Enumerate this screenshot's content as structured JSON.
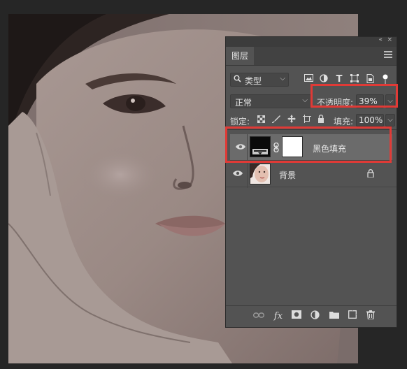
{
  "panel": {
    "collapse_icon": "«",
    "close_icon": "×",
    "tab_label": "图层",
    "menu_icon": "panel-menu-icon"
  },
  "filter": {
    "icon": "🔍",
    "label": "类型",
    "chevron": "⌵",
    "icons": [
      "image-filter-icon",
      "adjustment-filter-icon",
      "type-filter-icon",
      "shape-filter-icon",
      "smart-object-filter-icon",
      "filter-toggle-icon"
    ]
  },
  "blend": {
    "mode": "正常",
    "chevron": "⌵",
    "opacity_label": "不透明度:",
    "opacity_value": "39%",
    "opacity_chevron": "⌵"
  },
  "lock": {
    "label": "锁定:",
    "fill_label": "填充:",
    "fill_value": "100%",
    "fill_chevron": "⌵"
  },
  "layers": [
    {
      "name": "黑色填充",
      "selected": true,
      "visible": true,
      "type": "fill-with-mask"
    },
    {
      "name": "背景",
      "selected": false,
      "visible": true,
      "locked": true,
      "type": "image"
    }
  ],
  "footer_icons": [
    "link-layers-icon",
    "fx-icon",
    "add-mask-icon",
    "new-adjustment-icon",
    "new-group-icon",
    "new-layer-icon",
    "delete-layer-icon"
  ],
  "colors": {
    "highlight": "#e03a36",
    "panel_bg": "#535353",
    "selected_row": "#6b6b6b"
  }
}
